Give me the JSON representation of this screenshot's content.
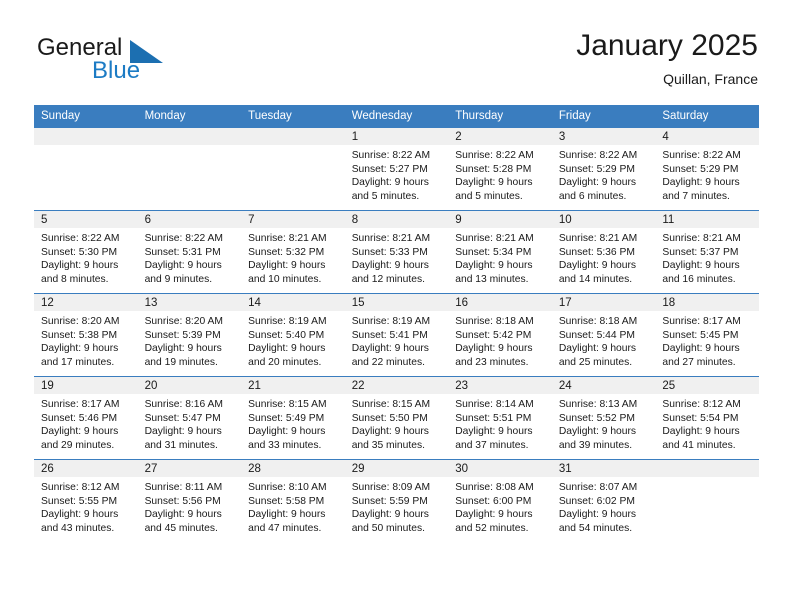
{
  "brand": {
    "name_part1": "General",
    "name_part2": "Blue",
    "logo_icon": "triangle-flag-icon",
    "accent_color": "#1c7bc4"
  },
  "header": {
    "title": "January 2025",
    "location": "Quillan, France"
  },
  "calendar": {
    "header_bg": "#3a7dbf",
    "daynum_bg": "#f0f0f0",
    "weekdays": [
      "Sunday",
      "Monday",
      "Tuesday",
      "Wednesday",
      "Thursday",
      "Friday",
      "Saturday"
    ],
    "weeks": [
      [
        {
          "day": "",
          "blank": true
        },
        {
          "day": "",
          "blank": true
        },
        {
          "day": "",
          "blank": true
        },
        {
          "day": "1",
          "sunrise": "Sunrise: 8:22 AM",
          "sunset": "Sunset: 5:27 PM",
          "daylight": "Daylight: 9 hours and 5 minutes."
        },
        {
          "day": "2",
          "sunrise": "Sunrise: 8:22 AM",
          "sunset": "Sunset: 5:28 PM",
          "daylight": "Daylight: 9 hours and 5 minutes."
        },
        {
          "day": "3",
          "sunrise": "Sunrise: 8:22 AM",
          "sunset": "Sunset: 5:29 PM",
          "daylight": "Daylight: 9 hours and 6 minutes."
        },
        {
          "day": "4",
          "sunrise": "Sunrise: 8:22 AM",
          "sunset": "Sunset: 5:29 PM",
          "daylight": "Daylight: 9 hours and 7 minutes."
        }
      ],
      [
        {
          "day": "5",
          "sunrise": "Sunrise: 8:22 AM",
          "sunset": "Sunset: 5:30 PM",
          "daylight": "Daylight: 9 hours and 8 minutes."
        },
        {
          "day": "6",
          "sunrise": "Sunrise: 8:22 AM",
          "sunset": "Sunset: 5:31 PM",
          "daylight": "Daylight: 9 hours and 9 minutes."
        },
        {
          "day": "7",
          "sunrise": "Sunrise: 8:21 AM",
          "sunset": "Sunset: 5:32 PM",
          "daylight": "Daylight: 9 hours and 10 minutes."
        },
        {
          "day": "8",
          "sunrise": "Sunrise: 8:21 AM",
          "sunset": "Sunset: 5:33 PM",
          "daylight": "Daylight: 9 hours and 12 minutes."
        },
        {
          "day": "9",
          "sunrise": "Sunrise: 8:21 AM",
          "sunset": "Sunset: 5:34 PM",
          "daylight": "Daylight: 9 hours and 13 minutes."
        },
        {
          "day": "10",
          "sunrise": "Sunrise: 8:21 AM",
          "sunset": "Sunset: 5:36 PM",
          "daylight": "Daylight: 9 hours and 14 minutes."
        },
        {
          "day": "11",
          "sunrise": "Sunrise: 8:21 AM",
          "sunset": "Sunset: 5:37 PM",
          "daylight": "Daylight: 9 hours and 16 minutes."
        }
      ],
      [
        {
          "day": "12",
          "sunrise": "Sunrise: 8:20 AM",
          "sunset": "Sunset: 5:38 PM",
          "daylight": "Daylight: 9 hours and 17 minutes."
        },
        {
          "day": "13",
          "sunrise": "Sunrise: 8:20 AM",
          "sunset": "Sunset: 5:39 PM",
          "daylight": "Daylight: 9 hours and 19 minutes."
        },
        {
          "day": "14",
          "sunrise": "Sunrise: 8:19 AM",
          "sunset": "Sunset: 5:40 PM",
          "daylight": "Daylight: 9 hours and 20 minutes."
        },
        {
          "day": "15",
          "sunrise": "Sunrise: 8:19 AM",
          "sunset": "Sunset: 5:41 PM",
          "daylight": "Daylight: 9 hours and 22 minutes."
        },
        {
          "day": "16",
          "sunrise": "Sunrise: 8:18 AM",
          "sunset": "Sunset: 5:42 PM",
          "daylight": "Daylight: 9 hours and 23 minutes."
        },
        {
          "day": "17",
          "sunrise": "Sunrise: 8:18 AM",
          "sunset": "Sunset: 5:44 PM",
          "daylight": "Daylight: 9 hours and 25 minutes."
        },
        {
          "day": "18",
          "sunrise": "Sunrise: 8:17 AM",
          "sunset": "Sunset: 5:45 PM",
          "daylight": "Daylight: 9 hours and 27 minutes."
        }
      ],
      [
        {
          "day": "19",
          "sunrise": "Sunrise: 8:17 AM",
          "sunset": "Sunset: 5:46 PM",
          "daylight": "Daylight: 9 hours and 29 minutes."
        },
        {
          "day": "20",
          "sunrise": "Sunrise: 8:16 AM",
          "sunset": "Sunset: 5:47 PM",
          "daylight": "Daylight: 9 hours and 31 minutes."
        },
        {
          "day": "21",
          "sunrise": "Sunrise: 8:15 AM",
          "sunset": "Sunset: 5:49 PM",
          "daylight": "Daylight: 9 hours and 33 minutes."
        },
        {
          "day": "22",
          "sunrise": "Sunrise: 8:15 AM",
          "sunset": "Sunset: 5:50 PM",
          "daylight": "Daylight: 9 hours and 35 minutes."
        },
        {
          "day": "23",
          "sunrise": "Sunrise: 8:14 AM",
          "sunset": "Sunset: 5:51 PM",
          "daylight": "Daylight: 9 hours and 37 minutes."
        },
        {
          "day": "24",
          "sunrise": "Sunrise: 8:13 AM",
          "sunset": "Sunset: 5:52 PM",
          "daylight": "Daylight: 9 hours and 39 minutes."
        },
        {
          "day": "25",
          "sunrise": "Sunrise: 8:12 AM",
          "sunset": "Sunset: 5:54 PM",
          "daylight": "Daylight: 9 hours and 41 minutes."
        }
      ],
      [
        {
          "day": "26",
          "sunrise": "Sunrise: 8:12 AM",
          "sunset": "Sunset: 5:55 PM",
          "daylight": "Daylight: 9 hours and 43 minutes."
        },
        {
          "day": "27",
          "sunrise": "Sunrise: 8:11 AM",
          "sunset": "Sunset: 5:56 PM",
          "daylight": "Daylight: 9 hours and 45 minutes."
        },
        {
          "day": "28",
          "sunrise": "Sunrise: 8:10 AM",
          "sunset": "Sunset: 5:58 PM",
          "daylight": "Daylight: 9 hours and 47 minutes."
        },
        {
          "day": "29",
          "sunrise": "Sunrise: 8:09 AM",
          "sunset": "Sunset: 5:59 PM",
          "daylight": "Daylight: 9 hours and 50 minutes."
        },
        {
          "day": "30",
          "sunrise": "Sunrise: 8:08 AM",
          "sunset": "Sunset: 6:00 PM",
          "daylight": "Daylight: 9 hours and 52 minutes."
        },
        {
          "day": "31",
          "sunrise": "Sunrise: 8:07 AM",
          "sunset": "Sunset: 6:02 PM",
          "daylight": "Daylight: 9 hours and 54 minutes."
        },
        {
          "day": "",
          "blank": true
        }
      ]
    ]
  }
}
